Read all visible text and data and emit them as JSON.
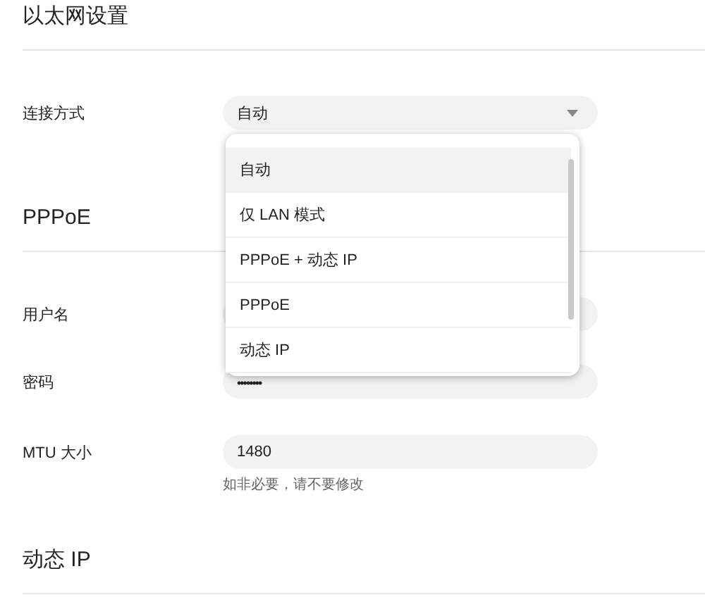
{
  "sections": [
    {
      "title": "以太网设置",
      "fields": [
        {
          "kind": "select",
          "label": "连接方式",
          "value": "自动"
        }
      ]
    },
    {
      "title": "PPPoE",
      "fields": [
        {
          "kind": "text",
          "label": "用户名"
        },
        {
          "kind": "password",
          "label": "密码",
          "value": "••••••••"
        },
        {
          "kind": "text",
          "label": "MTU 大小",
          "value": "1480",
          "hint": "如非必要，请不要修改"
        }
      ]
    },
    {
      "title": "动态 IP"
    }
  ],
  "dropdown_menu": {
    "items": [
      {
        "label": "自动",
        "selected": true
      },
      {
        "label": "仅 LAN 模式",
        "selected": false
      },
      {
        "label": "PPPoE + 动态 IP",
        "selected": false
      },
      {
        "label": "PPPoE",
        "selected": false
      },
      {
        "label": "动态 IP",
        "selected": false
      }
    ]
  }
}
